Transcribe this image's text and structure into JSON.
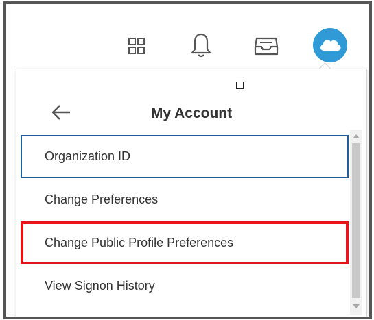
{
  "header": {
    "icons": [
      "apps-grid-icon",
      "notifications-bell-icon",
      "inbox-tray-icon",
      "cloud-avatar-icon"
    ],
    "avatar_color": "#2f9ad6"
  },
  "panel": {
    "title": "My Account",
    "back_icon": "arrow-left-icon",
    "items": [
      {
        "label": "Organization ID",
        "state": "focused"
      },
      {
        "label": "Change Preferences",
        "state": "normal"
      },
      {
        "label": "Change Public Profile Preferences",
        "state": "highlighted"
      },
      {
        "label": "View Signon History",
        "state": "normal"
      }
    ]
  },
  "colors": {
    "focus_border": "#1f5f9e",
    "highlight_border": "#e8141b",
    "text": "#333333",
    "frame_border": "#555555"
  }
}
